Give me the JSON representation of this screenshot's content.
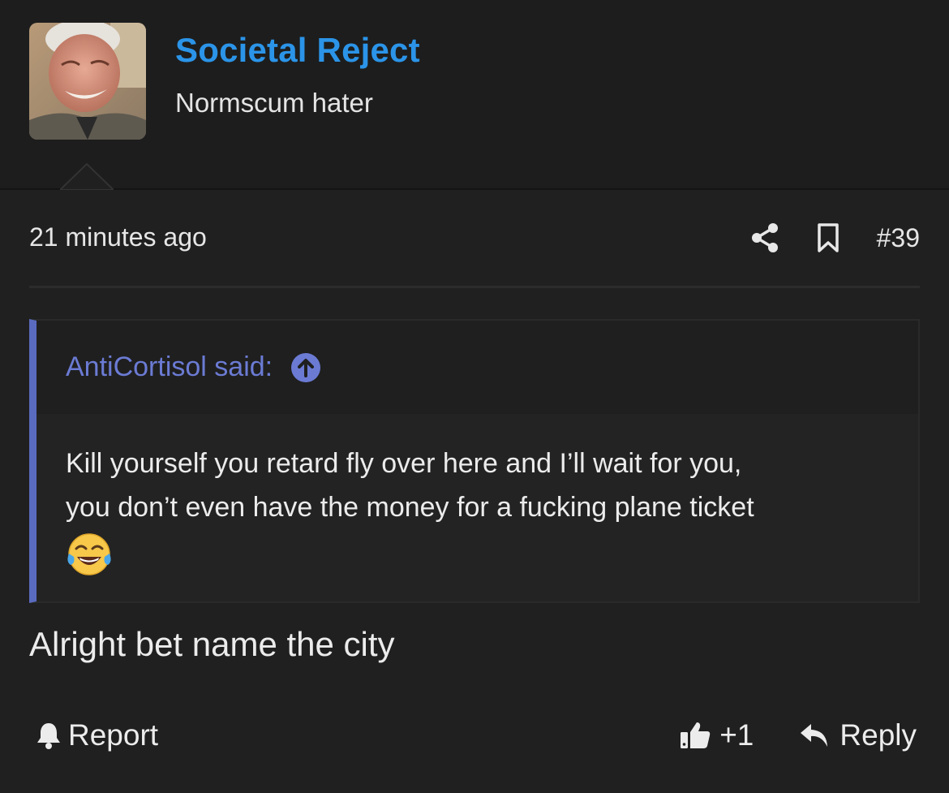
{
  "user": {
    "name": "Societal Reject",
    "title": "Normscum hater"
  },
  "post": {
    "time": "21 minutes ago",
    "number": "#39",
    "body": "Alright bet name the city"
  },
  "quote": {
    "author": "AntiCortisol said:",
    "line1": "Kill yourself you retard fly over here and I’ll wait for you,",
    "line2": "you don’t even have the money for a fucking plane ticket"
  },
  "footer": {
    "report_label": "Report",
    "like_count": "+1",
    "reply_label": "Reply"
  },
  "icons": {
    "share": "share-icon",
    "bookmark": "bookmark-icon",
    "jump": "arrow-up-circle-icon",
    "report": "bell-icon",
    "like": "thumbs-up-icon",
    "reply": "reply-arrow-icon",
    "emoji": "tears-of-joy-emoji"
  },
  "colors": {
    "username": "#2b94e8",
    "quote_accent": "#5a6bbf",
    "quote_author": "#6b7bd4",
    "background": "#202020"
  }
}
